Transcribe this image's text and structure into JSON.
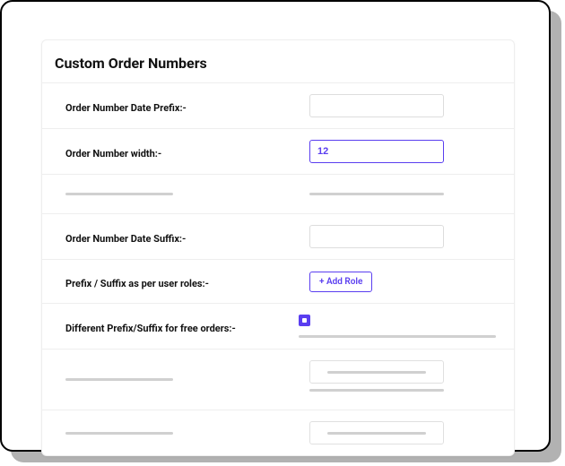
{
  "title": "Custom Order Numbers",
  "rows": {
    "date_prefix": {
      "label": "Order Number Date Prefix:-",
      "value": ""
    },
    "width": {
      "label": "Order Number width:-",
      "value": "12"
    },
    "date_suffix": {
      "label": "Order Number Date Suffix:-",
      "value": ""
    },
    "roles": {
      "label": "Prefix / Suffix as per user roles:-",
      "button": "+ Add Role"
    },
    "free_orders": {
      "label": "Different Prefix/Suffix for free orders:-",
      "checked": true
    }
  }
}
